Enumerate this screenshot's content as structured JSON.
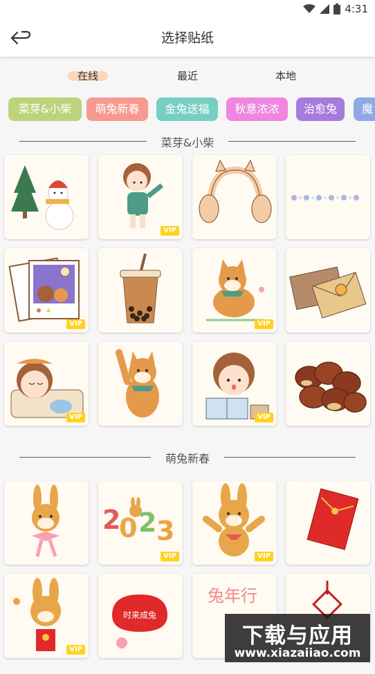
{
  "status_bar": {
    "time": "4:31"
  },
  "header": {
    "title": "选择贴纸"
  },
  "tabs": [
    "在线",
    "最近",
    "本地"
  ],
  "active_tab": "在线",
  "categories": [
    {
      "label": "菜芽&小柴",
      "color": "#bcd37a"
    },
    {
      "label": "萌兔新春",
      "color": "#f69a90"
    },
    {
      "label": "金兔送福",
      "color": "#77cfc4"
    },
    {
      "label": "秋意浓浓",
      "color": "#ef86e0"
    },
    {
      "label": "治愈兔",
      "color": "#a57bdb"
    },
    {
      "label": "魔",
      "color": "#8ea9e3"
    }
  ],
  "sections": [
    {
      "title": "菜芽&小柴",
      "stickers": [
        {
          "icon": "snowman-icon",
          "vip": ""
        },
        {
          "icon": "girl-waving-icon",
          "vip": "VIP"
        },
        {
          "icon": "earmuffs-icon",
          "vip": ""
        },
        {
          "icon": "flower-border-icon",
          "vip": ""
        },
        {
          "icon": "photo-frame-icon",
          "vip": "VIP"
        },
        {
          "icon": "bubble-tea-icon",
          "vip": ""
        },
        {
          "icon": "shiba-dog-icon",
          "vip": "VIP"
        },
        {
          "icon": "envelopes-icon",
          "vip": ""
        },
        {
          "icon": "sleeping-girl-icon",
          "vip": "VIP"
        },
        {
          "icon": "shiba-waving-icon",
          "vip": ""
        },
        {
          "icon": "girl-reading-icon",
          "vip": "VIP"
        },
        {
          "icon": "chestnuts-icon",
          "vip": ""
        }
      ]
    },
    {
      "title": "萌兔新春",
      "stickers": [
        {
          "icon": "rabbit-bow-icon",
          "vip": ""
        },
        {
          "icon": "year-2023-icon",
          "vip": "VIP"
        },
        {
          "icon": "rabbit-jumping-icon",
          "vip": "VIP"
        },
        {
          "icon": "red-envelope-icon",
          "vip": ""
        },
        {
          "icon": "rabbit-red-packet-icon",
          "vip": "VIP"
        },
        {
          "icon": "lucky-sign-icon",
          "vip": ""
        },
        {
          "icon": "rabbit-text-icon",
          "vip": ""
        },
        {
          "icon": "chinese-knot-icon",
          "vip": ""
        }
      ]
    }
  ],
  "section_texts": {
    "s2_sign": "时来成兔",
    "s2_poem": "兔年行"
  },
  "watermark": {
    "line1": "下载与应用",
    "line2": "www.xiazaiiao.com"
  }
}
